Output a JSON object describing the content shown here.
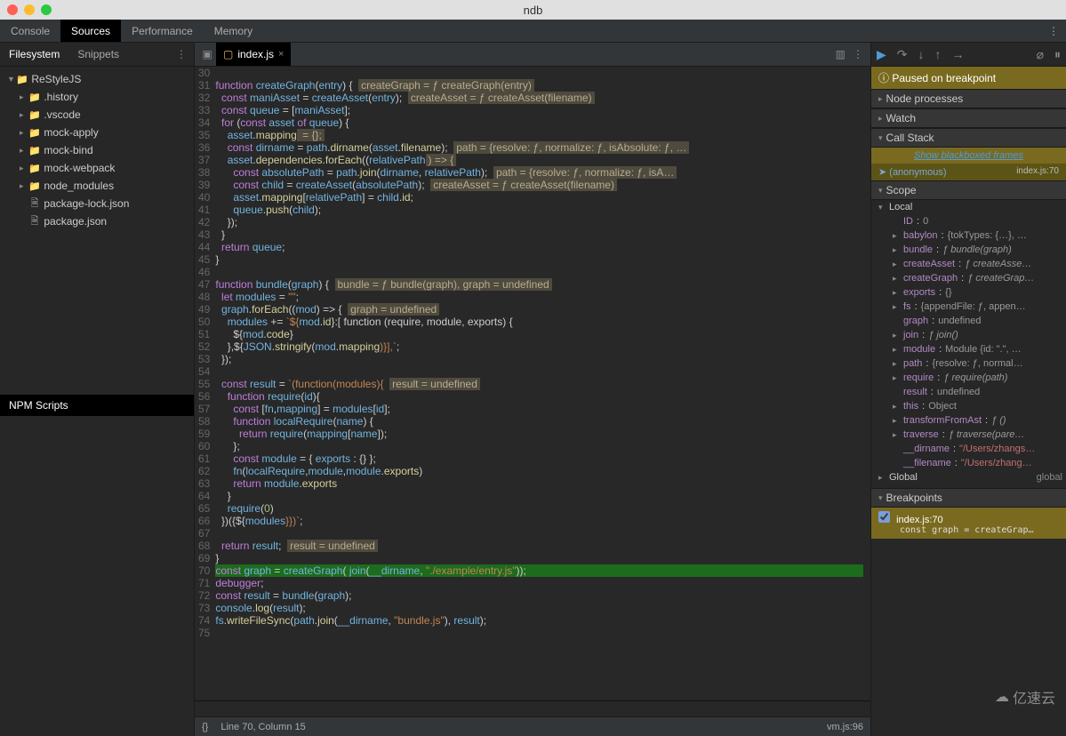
{
  "window": {
    "title": "ndb"
  },
  "mainTabs": {
    "t0": "Console",
    "t1": "Sources",
    "t2": "Performance",
    "t3": "Memory",
    "activeIndex": 1
  },
  "leftTabs": {
    "t0": "Filesystem",
    "t1": "Snippets",
    "activeIndex": 0
  },
  "fileTree": {
    "root": "ReStyleJS",
    "i0": ".history",
    "i1": ".vscode",
    "i2": "mock-apply",
    "i3": "mock-bind",
    "i4": "mock-webpack",
    "i5": "node_modules",
    "i6": "package-lock.json",
    "i7": "package.json"
  },
  "npmScripts": "NPM Scripts",
  "editor": {
    "filename": "index.js",
    "startLine": 30,
    "endLine": 75,
    "highlightLine": 70,
    "cursorInfo": "Line 70, Column 15",
    "vmInfo": "vm.js:96"
  },
  "code": {
    "l30": " ",
    "l31": [
      "function ",
      "createGraph",
      "(",
      "entry",
      ") {  ",
      "createGraph = ƒ createGraph(entry)"
    ],
    "l32": [
      "  const ",
      "maniAsset",
      " = ",
      "createAsset",
      "(",
      "entry",
      ");  ",
      "createAsset = ƒ createAsset(filename)"
    ],
    "l33": [
      "  const ",
      "queue",
      " = [",
      "maniAsset",
      "];"
    ],
    "l34": [
      "  for ",
      "(",
      "const ",
      "asset",
      " of ",
      "queue",
      ") {"
    ],
    "l35": [
      "    ",
      "asset",
      ".",
      "mapping",
      " = {};"
    ],
    "l36": [
      "    const ",
      "dirname",
      " = ",
      "path",
      ".",
      "dirname",
      "(",
      "asset",
      ".",
      "filename",
      ");  ",
      "path = {resolve: ƒ, normalize: ƒ, isAbsolute: ƒ, …"
    ],
    "l37": [
      "    ",
      "asset",
      ".",
      "dependencies",
      ".",
      "forEach",
      "((",
      "relativePath",
      ") => {"
    ],
    "l38": [
      "      const ",
      "absolutePath",
      " = ",
      "path",
      ".",
      "join",
      "(",
      "dirname",
      ", ",
      "relativePath",
      ");  ",
      "path = {resolve: ƒ, normalize: ƒ, isA…"
    ],
    "l39": [
      "      const ",
      "child",
      " = ",
      "createAsset",
      "(",
      "absolutePath",
      ");  ",
      "createAsset = ƒ createAsset(filename)"
    ],
    "l40": [
      "      ",
      "asset",
      ".",
      "mapping",
      "[",
      "relativePath",
      "] = ",
      "child",
      ".",
      "id",
      ";"
    ],
    "l41": [
      "      ",
      "queue",
      ".",
      "push",
      "(",
      "child",
      ");"
    ],
    "l42": "    });",
    "l43": "  }",
    "l44": [
      "  return ",
      "queue",
      ";"
    ],
    "l45": "}",
    "l46": " ",
    "l47": [
      "function ",
      "bundle",
      "(",
      "graph",
      ") {  ",
      "bundle = ƒ bundle(graph), graph = undefined"
    ],
    "l48": [
      "  let ",
      "modules",
      " = ",
      "\"\"",
      ";"
    ],
    "l49": [
      "  ",
      "graph",
      ".",
      "forEach",
      "((",
      "mod",
      ") => {  ",
      "graph = undefined"
    ],
    "l50": [
      "    ",
      "modules",
      " += ",
      "`${",
      "mod",
      ".",
      "id",
      "}:[ function (require, module, exports) {"
    ],
    "l51": [
      "      ${",
      "mod",
      ".",
      "code",
      "}"
    ],
    "l52": [
      "    },${",
      "JSON",
      ".",
      "stringify",
      "(",
      "mod",
      ".",
      "mapping",
      ")}],`",
      ";"
    ],
    "l53": "  });",
    "l54": " ",
    "l55": [
      "  const ",
      "result",
      " = ",
      "`(function(modules){",
      "  ",
      "result = undefined"
    ],
    "l56": [
      "    function ",
      "require",
      "(",
      "id",
      "){"
    ],
    "l57": [
      "      const ",
      "[",
      "fn",
      ",",
      "mapping",
      "] = ",
      "modules",
      "[",
      "id",
      "];"
    ],
    "l58": [
      "      function ",
      "localRequire",
      "(",
      "name",
      ") {"
    ],
    "l59": [
      "        return ",
      "require",
      "(",
      "mapping",
      "[",
      "name",
      "]);"
    ],
    "l60": "      };",
    "l61": [
      "      const ",
      "module",
      " = { ",
      "exports",
      " : {} };"
    ],
    "l62": [
      "      ",
      "fn",
      "(",
      "localRequire",
      ",",
      "module",
      ",",
      "module",
      ".",
      "exports",
      ")"
    ],
    "l63": [
      "      return ",
      "module",
      ".",
      "exports"
    ],
    "l64": "    }",
    "l65": [
      "    ",
      "require",
      "(",
      "0",
      ")"
    ],
    "l66": [
      "  })({${",
      "modules",
      "}})`",
      ";"
    ],
    "l67": " ",
    "l68": [
      "  return ",
      "result",
      ";  ",
      "result = undefined"
    ],
    "l69": "}",
    "l70": [
      "const ",
      "graph",
      " = ",
      "createGraph",
      "( ",
      "join",
      "(",
      "__dirname",
      ", ",
      "\"./example/entry.js\"",
      "));"
    ],
    "l71": [
      "debugger",
      ";"
    ],
    "l72": [
      "const ",
      "result",
      " = ",
      "bundle",
      "(",
      "graph",
      ");"
    ],
    "l73": [
      "console",
      ".",
      "log",
      "(",
      "result",
      ");"
    ],
    "l74": [
      "fs",
      ".",
      "writeFileSync",
      "(",
      "path",
      ".",
      "join",
      "(",
      "__dirname",
      ", ",
      "\"bundle.js\"",
      "), ",
      "result",
      ");"
    ],
    "l75": " "
  },
  "debugger": {
    "pauseMessage": "Paused on breakpoint",
    "sections": {
      "nodeProcesses": "Node processes",
      "watch": "Watch",
      "callStack": "Call Stack",
      "scope": "Scope",
      "breakpoints": "Breakpoints"
    },
    "blackboxed": "Show blackboxed frames",
    "stackFrame": {
      "name": "(anonymous)",
      "location": "index.js:70"
    },
    "scopeLocal": "Local",
    "scopeGlobal": "Global",
    "scopeGlobalVal": "global",
    "scope": {
      "ID": [
        "ID",
        ": ",
        "0"
      ],
      "babylon": [
        "babylon",
        ": ",
        "{tokTypes: {…}, …"
      ],
      "bundle": [
        "bundle",
        ": ",
        "ƒ bundle(graph)"
      ],
      "createAsset": [
        "createAsset",
        ": ",
        "ƒ createAsse…"
      ],
      "createGraph": [
        "createGraph",
        ": ",
        "ƒ createGrap…"
      ],
      "exports": [
        "exports",
        ": ",
        "{}"
      ],
      "fs": [
        "fs",
        ": ",
        "{appendFile: ƒ, appen…"
      ],
      "graph": [
        "graph",
        ": ",
        "undefined"
      ],
      "join": [
        "join",
        ": ",
        "ƒ join()"
      ],
      "module": [
        "module",
        ": ",
        "Module {id: \".\", …"
      ],
      "path": [
        "path",
        ": ",
        "{resolve: ƒ, normal…"
      ],
      "require": [
        "require",
        ": ",
        "ƒ require(path)"
      ],
      "result": [
        "result",
        ": ",
        "undefined"
      ],
      "this": [
        "this",
        ": ",
        "Object"
      ],
      "transformFromAst": [
        "transformFromAst",
        ": ",
        "ƒ ()"
      ],
      "traverse": [
        "traverse",
        ": ",
        "ƒ traverse(pare…"
      ],
      "dirname": [
        "__dirname",
        ": ",
        "\"/Users/zhangs…"
      ],
      "filename": [
        "__filename",
        ": ",
        "\"/Users/zhang…"
      ]
    },
    "breakpoint": {
      "label": "index.js:70",
      "code": "const graph = createGrap…"
    }
  },
  "watermark": "亿速云"
}
